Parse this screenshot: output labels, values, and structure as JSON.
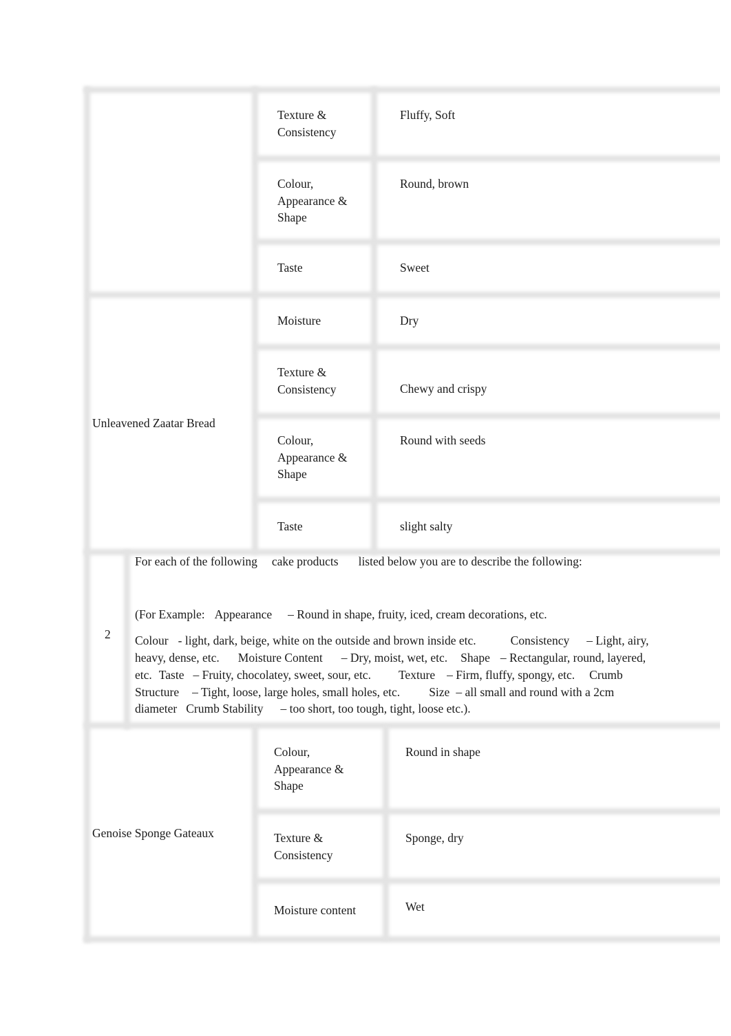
{
  "section1_continued": {
    "product": "",
    "rows": [
      {
        "attribute": "Texture & Consistency",
        "attribute_lines": [
          "Texture &",
          "Consistency"
        ],
        "value": "Fluffy, Soft"
      },
      {
        "attribute": "Colour, Appearance & Shape",
        "attribute_lines": [
          "Colour,",
          "Appearance &",
          "Shape"
        ],
        "value": "Round, brown"
      },
      {
        "attribute": "Taste",
        "attribute_lines": [
          "Taste"
        ],
        "value": "Sweet"
      }
    ]
  },
  "zaatar": {
    "product": "Unleavened Zaatar Bread",
    "rows": [
      {
        "attribute": "Moisture",
        "attribute_lines": [
          "Moisture"
        ],
        "value": "Dry"
      },
      {
        "attribute": "Texture & Consistency",
        "attribute_lines": [
          "Texture &",
          "Consistency"
        ],
        "value": "Chewy and crispy"
      },
      {
        "attribute": "Colour, Appearance & Shape",
        "attribute_lines": [
          "Colour,",
          "Appearance &",
          "Shape"
        ],
        "value": "Round with seeds"
      },
      {
        "attribute": "Taste",
        "attribute_lines": [
          "Taste"
        ],
        "value": "slight salty"
      }
    ]
  },
  "question2": {
    "number": "2",
    "intro": [
      "For each of the following",
      "cake products",
      "listed below you are to describe the following:"
    ],
    "example_line": [
      "(For Example:",
      "Appearance",
      "– Round in shape, fruity, iced, cream decorations, etc."
    ],
    "criteria_lines": [
      [
        "Colour",
        "- light, dark, beige, white on the outside and brown inside etc.",
        "Consistency",
        "– Light, airy,"
      ],
      [
        "heavy, dense, etc.",
        "Moisture Content",
        "– Dry, moist, wet, etc.",
        "Shape",
        "– Rectangular, round, layered,"
      ],
      [
        "etc.",
        "Taste",
        "– Fruity, chocolatey, sweet, sour, etc.",
        "Texture",
        "– Firm, fluffy, spongy, etc.",
        "Crumb"
      ],
      [
        "Structure",
        "– Tight, loose, large holes, small holes, etc.",
        "Size",
        "– all small and round with a 2cm"
      ],
      [
        "diameter",
        "Crumb Stability",
        "– too short, too tough, tight, loose etc.)."
      ]
    ]
  },
  "genoise": {
    "product": "Genoise Sponge Gateaux",
    "rows": [
      {
        "attribute": "Colour, Appearance & Shape",
        "attribute_lines": [
          "Colour,",
          "Appearance &",
          "Shape"
        ],
        "value": "Round in shape"
      },
      {
        "attribute": "Texture & Consistency",
        "attribute_lines": [
          "Texture &",
          "Consistency"
        ],
        "value": "Sponge, dry"
      },
      {
        "attribute": "Moisture content",
        "attribute_lines": [
          "Moisture content"
        ],
        "value": "Wet"
      }
    ]
  },
  "colors": {
    "grid_line": "#e3e3e3",
    "text": "#1a1a1a",
    "background": "#ffffff"
  }
}
